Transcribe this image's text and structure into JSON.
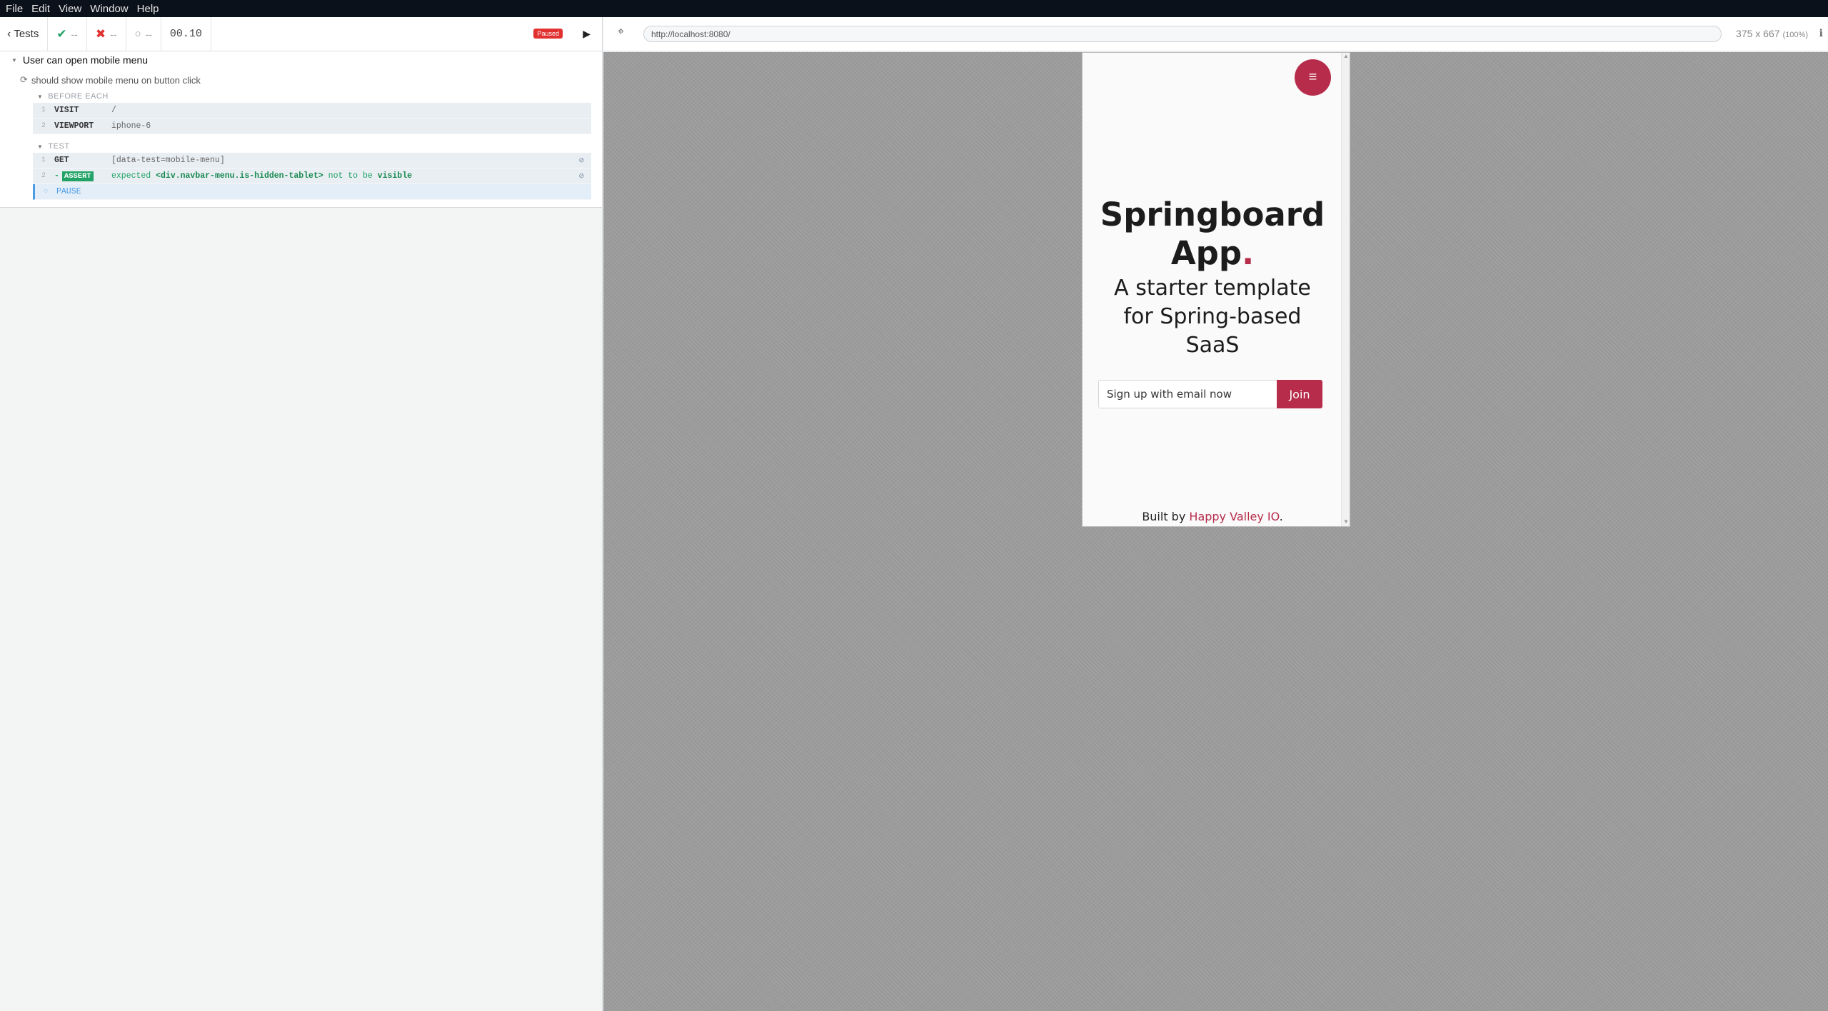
{
  "menubar": {
    "items": [
      "File",
      "Edit",
      "View",
      "Window",
      "Help"
    ]
  },
  "reporter": {
    "back_label": "Tests",
    "passed": "--",
    "failed": "--",
    "pending": "--",
    "duration": "00.10",
    "status_badge": "Paused",
    "suite_title": "User can open mobile menu",
    "test_title": "should show mobile menu on button click",
    "before_each_label": "BEFORE EACH",
    "before_each": [
      {
        "num": "1",
        "name": "VISIT",
        "message": "/"
      },
      {
        "num": "2",
        "name": "VIEWPORT",
        "message": "iphone-6"
      }
    ],
    "test_label": "TEST",
    "test_commands": [
      {
        "num": "1",
        "name": "GET",
        "message": "[data-test=mobile-menu]"
      },
      {
        "num": "2",
        "name": "ASSERT",
        "expected": "expected",
        "subject": "<div.navbar-menu.is-hidden-tablet>",
        "not_to_be": "not to be",
        "visible": "visible"
      },
      {
        "num": "",
        "name": "PAUSE"
      }
    ]
  },
  "aut": {
    "url": "http://localhost:8080/",
    "viewport_size": "375 x 667",
    "zoom": "(100%)"
  },
  "app": {
    "title_line1": "Springboard",
    "title_line2": "App",
    "title_dot": ".",
    "subtitle": "A starter template for Spring-based SaaS",
    "email_placeholder": "Sign up with email now",
    "join_label": "Join",
    "footer_prefix": "Built by",
    "footer_link": "Happy Valley IO",
    "footer_suffix": "."
  },
  "colors": {
    "brand": "#b62c4a",
    "pass": "#21a366",
    "fail": "#e0302f"
  }
}
